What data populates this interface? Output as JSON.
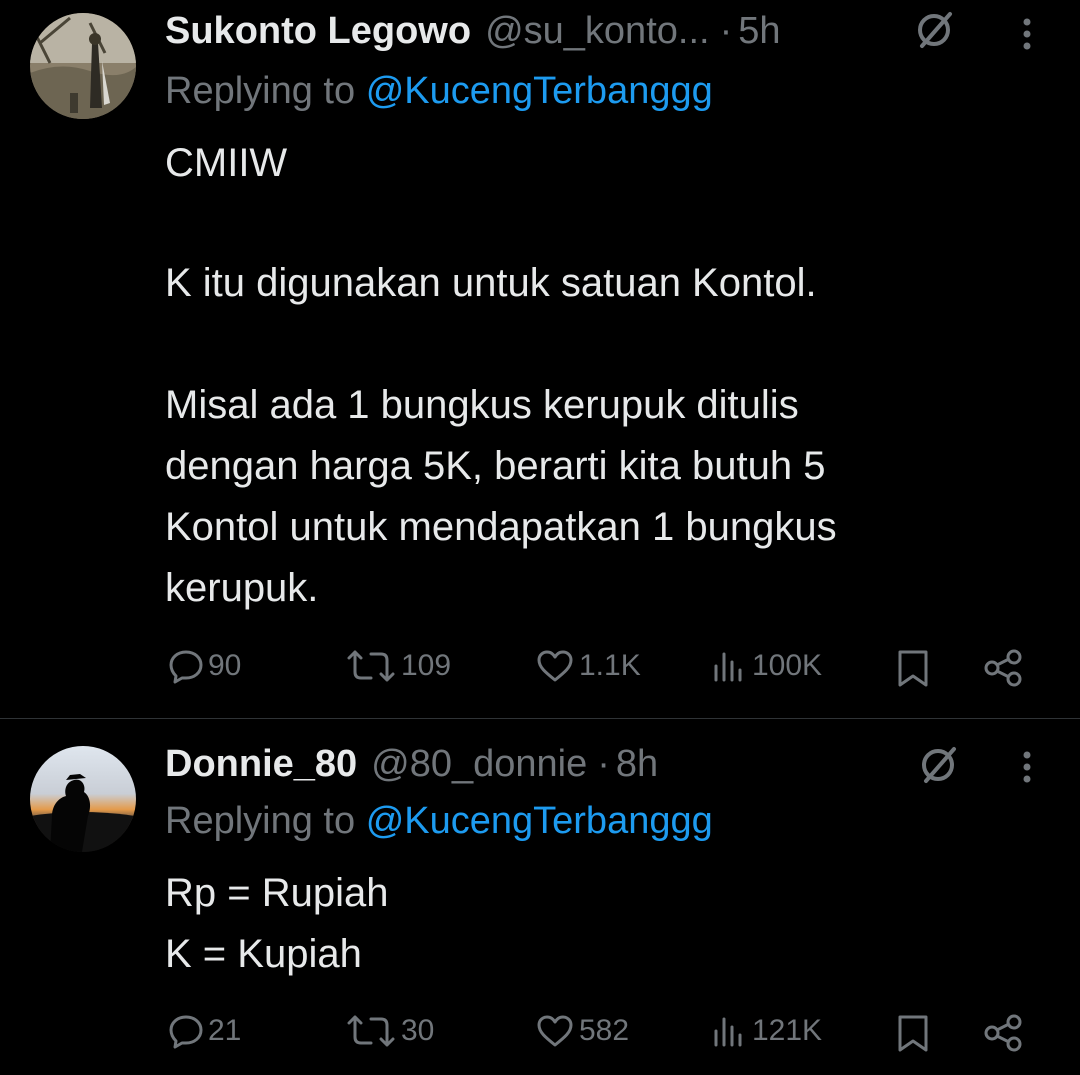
{
  "tweets": [
    {
      "name": "Sukonto Legowo",
      "handle": "@su_konto...",
      "dot": "·",
      "time": "5h",
      "replying_prefix": "Replying to",
      "replying_to": "@KucengTerbanggg",
      "body_lines": [
        "CMIIW",
        "K itu digunakan untuk satuan Kontol.",
        "Misal ada 1 bungkus kerupuk ditulis",
        "dengan harga 5K, berarti kita butuh 5",
        "Kontol untuk mendapatkan 1 bungkus",
        "kerupuk."
      ],
      "actions": {
        "replies": "90",
        "retweets": "109",
        "likes": "1.1K",
        "views": "100K"
      }
    },
    {
      "name": "Donnie_80",
      "handle": "@80_donnie",
      "dot": "·",
      "time": "8h",
      "replying_prefix": "Replying to",
      "replying_to": "@KucengTerbanggg",
      "body_lines": [
        "Rp = Rupiah",
        "K = Kupiah"
      ],
      "actions": {
        "replies": "21",
        "retweets": "30",
        "likes": "582",
        "views": "121K"
      }
    }
  ],
  "icons": {
    "grok": "grok-icon",
    "more": "more-icon",
    "reply": "reply-icon",
    "retweet": "retweet-icon",
    "like": "like-icon",
    "views": "views-icon",
    "bookmark": "bookmark-icon",
    "share": "share-icon"
  },
  "colors": {
    "background": "#000000",
    "text": "#e7e9ea",
    "muted": "#71767b",
    "link": "#1d9bf0",
    "divider": "#2f3336"
  }
}
